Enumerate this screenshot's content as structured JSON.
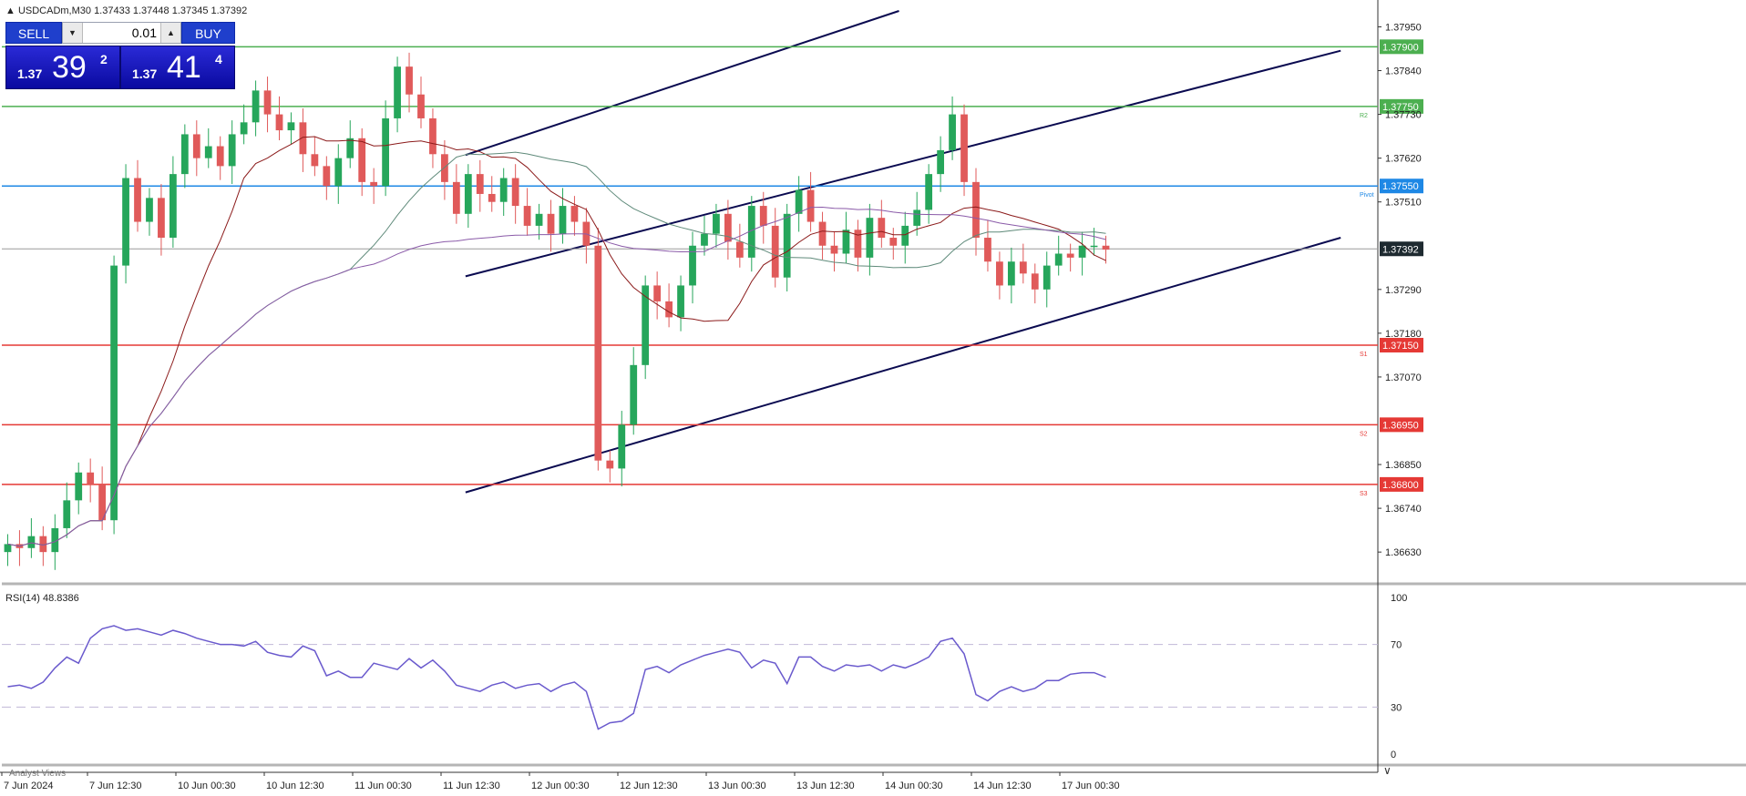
{
  "header": {
    "symbol_text": "USDCADm,M30",
    "ohlc_text": "1.37433 1.37448 1.37345 1.37392",
    "menu_icon": "triangle-up-icon"
  },
  "trade_panel": {
    "sell_label": "SELL",
    "buy_label": "BUY",
    "lot_value": "0.01",
    "sell_small": "1.37",
    "sell_big": "39",
    "sell_sup": "2",
    "buy_small": "1.37",
    "buy_big": "41",
    "buy_sup": "4",
    "button_color": "#1f3fcc"
  },
  "price_axis": {
    "ticks": [
      "1.37950",
      "1.37840",
      "1.37730",
      "1.37620",
      "1.37510",
      "1.37290",
      "1.37180",
      "1.37070",
      "1.36850",
      "1.36740",
      "1.36630"
    ],
    "current_price": "1.37392"
  },
  "levels": [
    {
      "price": 1.379,
      "label": "1.37900",
      "tag": "",
      "color": "#4caf50"
    },
    {
      "price": 1.3775,
      "label": "1.37750",
      "tag": "R2",
      "color": "#4caf50"
    },
    {
      "price": 1.3755,
      "label": "1.37550",
      "tag": "Pivot",
      "color": "#1e88e5"
    },
    {
      "price": 1.3715,
      "label": "1.37150",
      "tag": "S1",
      "color": "#e53935"
    },
    {
      "price": 1.3695,
      "label": "1.36950",
      "tag": "S2",
      "color": "#e53935"
    },
    {
      "price": 1.368,
      "label": "1.36800",
      "tag": "S3",
      "color": "#e53935"
    }
  ],
  "time_axis": {
    "labels": [
      "7 Jun 2024",
      "7 Jun 12:30",
      "10 Jun 00:30",
      "10 Jun 12:30",
      "11 Jun 00:30",
      "11 Jun 12:30",
      "12 Jun 00:30",
      "12 Jun 12:30",
      "13 Jun 00:30",
      "13 Jun 12:30",
      "14 Jun 00:30",
      "14 Jun 12:30",
      "17 Jun 00:30"
    ]
  },
  "rsi": {
    "label": "RSI(14) 48.8386",
    "levels": [
      {
        "value": 100,
        "label": "100"
      },
      {
        "value": 70,
        "label": "70"
      },
      {
        "value": 30,
        "label": "30"
      },
      {
        "value": 0,
        "label": "0"
      }
    ],
    "line_color": "#6a5acd"
  },
  "footer": {
    "analyst_text": "Analyst Views"
  },
  "colors": {
    "bull": "#26a65b",
    "bear": "#e05a5a",
    "channel": "#0a0a50",
    "ma1": "#8b1a1a",
    "ma2": "#5f8a7a",
    "ma3": "#8a5aa8",
    "current_price_bg": "#1e2a30"
  },
  "chart_data": {
    "type": "candlestick",
    "symbol": "USDCADm",
    "timeframe": "M30",
    "price_range": [
      1.3658,
      1.3799
    ],
    "last_price": 1.37392,
    "channel_lines": [
      {
        "from": {
          "bar": 0.337,
          "price": 1.37628
        },
        "to": {
          "bar": 0.652,
          "price": 1.3799
        }
      },
      {
        "from": {
          "bar": 0.337,
          "price": 1.37323
        },
        "to": {
          "bar": 0.973,
          "price": 1.3789
        }
      },
      {
        "from": {
          "bar": 0.337,
          "price": 1.3678
        },
        "to": {
          "bar": 0.973,
          "price": 1.3742
        }
      }
    ],
    "closes": [
      1.3665,
      1.3664,
      1.3667,
      1.3663,
      1.3669,
      1.3676,
      1.3683,
      1.368,
      1.3671,
      1.3735,
      1.3757,
      1.3746,
      1.3752,
      1.3742,
      1.3758,
      1.3768,
      1.3762,
      1.3765,
      1.376,
      1.3768,
      1.3771,
      1.3779,
      1.3773,
      1.3769,
      1.3771,
      1.3763,
      1.376,
      1.3755,
      1.3762,
      1.3767,
      1.3756,
      1.3755,
      1.3772,
      1.3785,
      1.3778,
      1.3772,
      1.3763,
      1.3756,
      1.3748,
      1.3758,
      1.3753,
      1.3751,
      1.3757,
      1.375,
      1.3745,
      1.3748,
      1.3743,
      1.375,
      1.3746,
      1.374,
      1.3686,
      1.3684,
      1.3695,
      1.371,
      1.373,
      1.3726,
      1.3722,
      1.373,
      1.374,
      1.3743,
      1.3748,
      1.3741,
      1.3737,
      1.375,
      1.3745,
      1.3732,
      1.3748,
      1.3754,
      1.3746,
      1.374,
      1.3738,
      1.3744,
      1.3737,
      1.3747,
      1.3742,
      1.374,
      1.3745,
      1.3749,
      1.3758,
      1.3764,
      1.3773,
      1.3756,
      1.3742,
      1.3736,
      1.373,
      1.3736,
      1.3733,
      1.3729,
      1.3735,
      1.3738,
      1.3737,
      1.374,
      1.374,
      1.3739
    ],
    "rsi_values": [
      43,
      44,
      42,
      46,
      55,
      62,
      58,
      74,
      80,
      82,
      79,
      80,
      78,
      76,
      79,
      77,
      74,
      72,
      70,
      70,
      69,
      72,
      65,
      63,
      62,
      69,
      66,
      50,
      53,
      49,
      49,
      58,
      56,
      54,
      61,
      55,
      60,
      53,
      44,
      42,
      40,
      44,
      46,
      42,
      44,
      45,
      40,
      44,
      46,
      40,
      16,
      20,
      21,
      26,
      54,
      56,
      52,
      57,
      60,
      63,
      65,
      67,
      65,
      55,
      60,
      58,
      45,
      62,
      62,
      56,
      53,
      57,
      56,
      57,
      53,
      57,
      55,
      58,
      62,
      72,
      74,
      64,
      38,
      34,
      40,
      43,
      40,
      42,
      47,
      47,
      51,
      52,
      52,
      49
    ]
  }
}
